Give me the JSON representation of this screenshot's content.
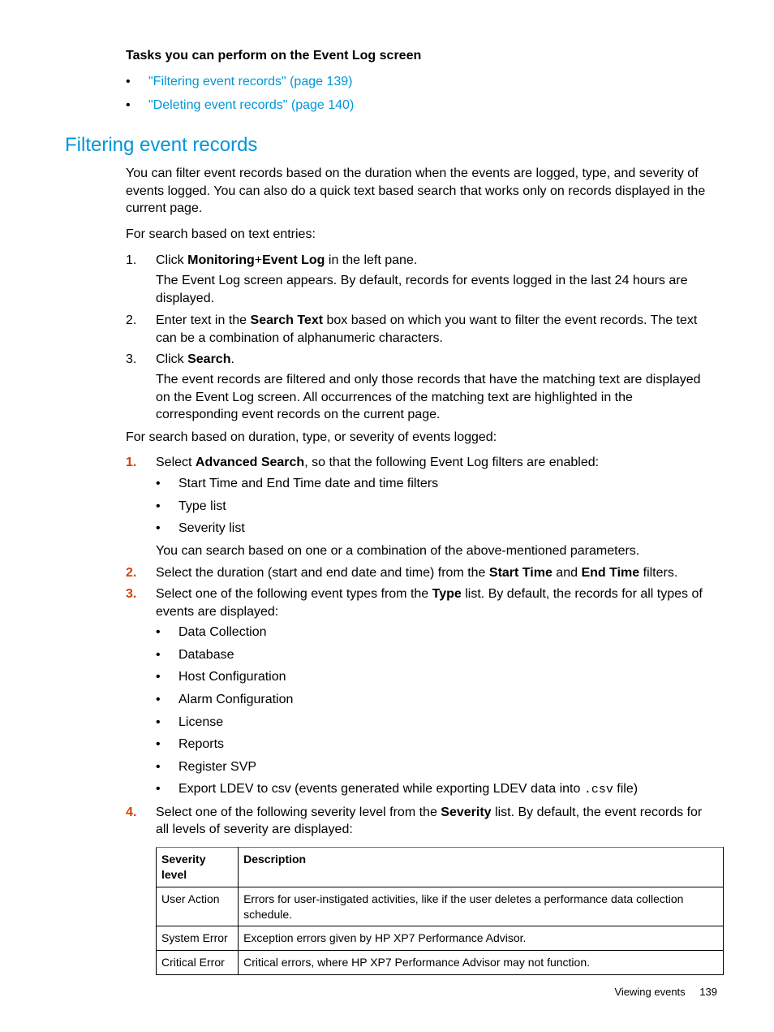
{
  "tasks_heading": "Tasks you can perform on the Event Log screen",
  "task_links": [
    "\"Filtering event records\" (page 139)",
    "\"Deleting event records\" (page 140)"
  ],
  "h2": "Filtering event records",
  "intro": "You can filter event records based on the duration when the events are logged, type, and severity of events logged. You can also do a quick text based search that works only on records displayed in the current page.",
  "text_search_lead": "For search based on text entries:",
  "step1_pre": "Click ",
  "step1_b1": "Monitoring",
  "step1_plus": "+",
  "step1_b2": "Event Log",
  "step1_post": " in the left pane.",
  "step1_sub": "The Event Log screen appears. By default, records for events logged in the last 24 hours are displayed.",
  "step2_pre": "Enter text in the ",
  "step2_b": "Search Text",
  "step2_post": " box based on which you want to filter the event records. The text can be a combination of alphanumeric characters.",
  "step3_pre": "Click ",
  "step3_b": "Search",
  "step3_post": ".",
  "step3_sub": "The event records are filtered and only those records that have the matching text are displayed on the Event Log screen. All occurrences of the matching text are highlighted in the corresponding event records on the current page.",
  "adv_lead": "For search based on duration, type, or severity of events logged:",
  "adv1_pre": "Select ",
  "adv1_b": "Advanced Search",
  "adv1_post": ", so that the following Event Log filters are enabled:",
  "adv1_bullets": [
    "Start Time and End Time date and time filters",
    "Type list",
    "Severity list"
  ],
  "adv1_tail": "You can search based on one or a combination of the above-mentioned parameters.",
  "adv2_pre": "Select the duration (start and end date and time) from the ",
  "adv2_b1": "Start Time",
  "adv2_mid": " and ",
  "adv2_b2": "End Time",
  "adv2_post": " filters.",
  "adv3_pre": "Select one of the following event types from the ",
  "adv3_b": "Type",
  "adv3_post": " list. By default, the records for all types of events are displayed:",
  "adv3_bullets": [
    "Data Collection",
    "Database",
    "Host Configuration",
    "Alarm Configuration",
    "License",
    "Reports",
    "Register SVP"
  ],
  "adv3_last_pre": "Export LDEV to csv (events generated while exporting LDEV data into ",
  "adv3_last_code": ".csv",
  "adv3_last_post": " file)",
  "adv4_pre": "Select one of the following severity level from the ",
  "adv4_b": "Severity",
  "adv4_post": " list. By default, the event records for all levels of severity are displayed:",
  "table": {
    "h1": "Severity level",
    "h2": "Description",
    "rows": [
      {
        "c1": "User Action",
        "c2": "Errors for user-instigated activities, like if the user deletes a performance data collection schedule."
      },
      {
        "c1": "System Error",
        "c2": "Exception errors given by HP XP7 Performance Advisor."
      },
      {
        "c1": "Critical Error",
        "c2": "Critical errors, where HP XP7 Performance Advisor may not function."
      }
    ]
  },
  "footer_label": "Viewing events",
  "footer_page": "139"
}
